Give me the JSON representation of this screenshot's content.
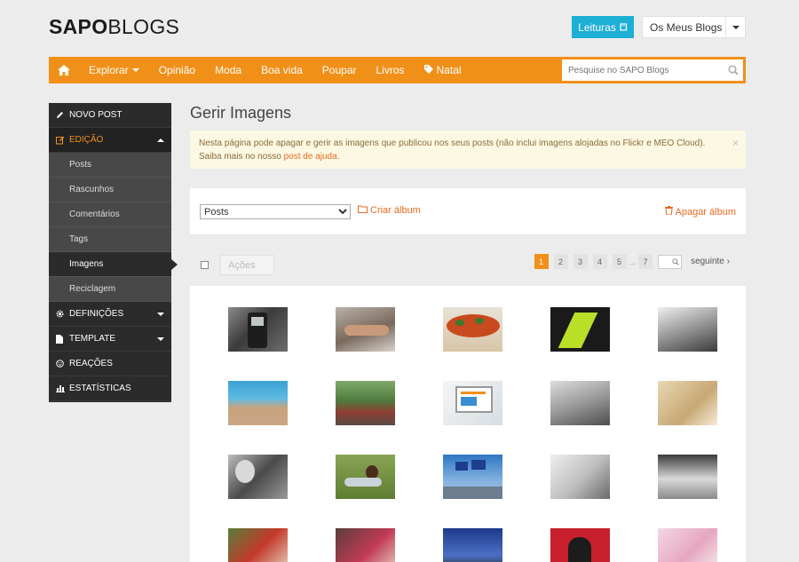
{
  "brand": {
    "bold": "SAPO",
    "thin": "BLOGS"
  },
  "header": {
    "leituras_label": "Leituras",
    "meus_blogs_label": "Os Meus Blogs"
  },
  "nav": {
    "items": [
      "Explorar",
      "Opinião",
      "Moda",
      "Boa vida",
      "Poupar",
      "Livros",
      "Natal"
    ],
    "search_placeholder": "Pesquise no SAPO Blogs"
  },
  "sidebar": {
    "novo_post": "NOVO POST",
    "edicao": "EDIÇÃO",
    "sub": [
      "Posts",
      "Rascunhos",
      "Comentários",
      "Tags",
      "Imagens",
      "Reciclagem"
    ],
    "definicoes": "DEFINIÇÕES",
    "template": "TEMPLATE",
    "reacoes": "REAÇÕES",
    "estatisticas": "ESTATÍSTICAS"
  },
  "main": {
    "title": "Gerir Imagens",
    "alert_line1": "Nesta página pode apagar e gerir as imagens que publicou nos seus posts (não inclui imagens alojadas no Flickr e MEO Cloud).",
    "alert_line2_prefix": "Saiba mais no nosso ",
    "alert_link": "post de ajuda",
    "alert_line2_suffix": ".",
    "close_symbol": "×",
    "select_value": "Posts",
    "criar_album": "Criar álbum",
    "apagar_album": "Apagar álbum",
    "acoes_placeholder": "Ações",
    "pages": [
      "1",
      "2",
      "3",
      "4",
      "5",
      "7"
    ],
    "dots": "...",
    "next_label": "seguinte"
  },
  "colors": {
    "accent": "#f19019",
    "link": "#e86a1f",
    "leituras": "#1dafd6",
    "sidebar": "#2b2b2b"
  }
}
